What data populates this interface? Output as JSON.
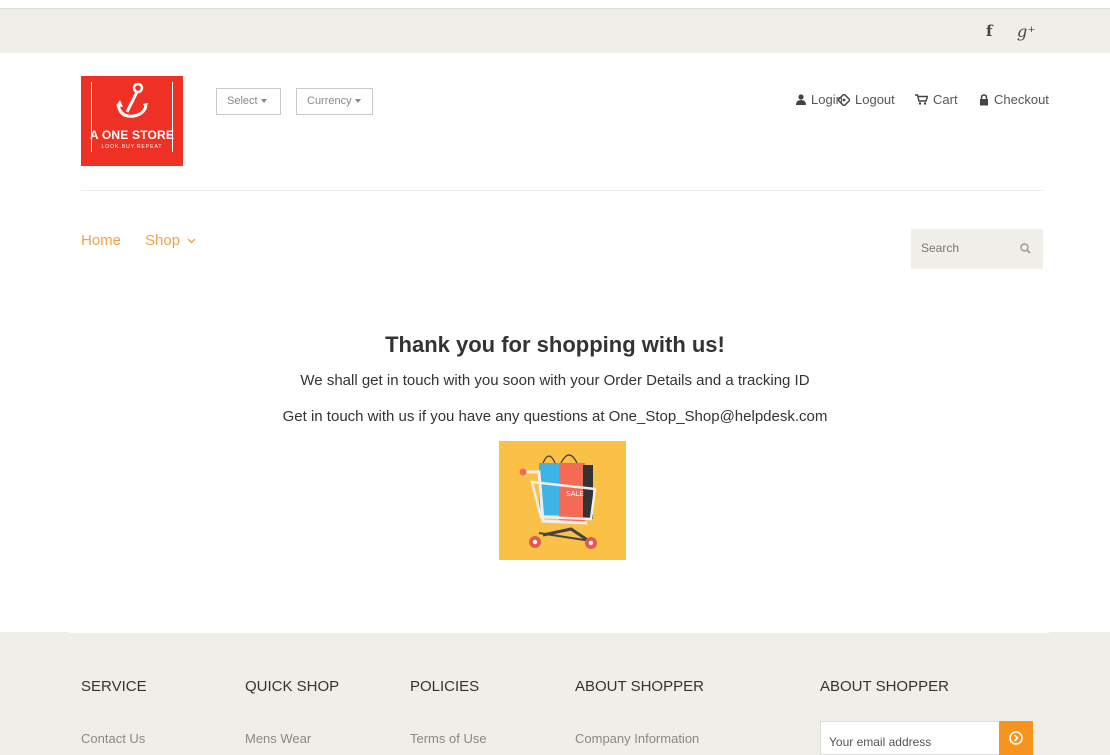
{
  "header": {
    "social": {
      "facebook": "f",
      "google_plus": "g⁺"
    },
    "logo": {
      "name": "A ONE STORE",
      "tagline": "LOOK.BUY.REPEAT"
    },
    "dropdowns": {
      "select": "Select",
      "currency": "Currency"
    },
    "account": {
      "login": "Login",
      "logout": "Logout",
      "cart": "Cart",
      "checkout": "Checkout"
    }
  },
  "nav": {
    "home": "Home",
    "shop": "Shop"
  },
  "search": {
    "placeholder": "Search"
  },
  "main": {
    "heading": "Thank you for shopping with us!",
    "line1": "We shall get in touch with you soon with your Order Details and a tracking ID",
    "line2": "Get in touch with us if you have any questions at One_Stop_Shop@helpdesk.com",
    "image_label": "SALE"
  },
  "footer": {
    "columns": [
      {
        "heading": "SERVICE",
        "link": "Contact Us"
      },
      {
        "heading": "QUICK SHOP",
        "link": "Mens Wear"
      },
      {
        "heading": "POLICIES",
        "link": "Terms of Use"
      },
      {
        "heading": "ABOUT SHOPPER",
        "link": "Company Information"
      },
      {
        "heading": "ABOUT SHOPPER"
      }
    ],
    "newsletter": {
      "placeholder": "Your email address"
    }
  },
  "colors": {
    "accent": "#f7941d",
    "nav": "#f0a44a",
    "logo_bg": "#ee3124",
    "band": "#efeee9",
    "hero_bg": "#fbc146"
  }
}
